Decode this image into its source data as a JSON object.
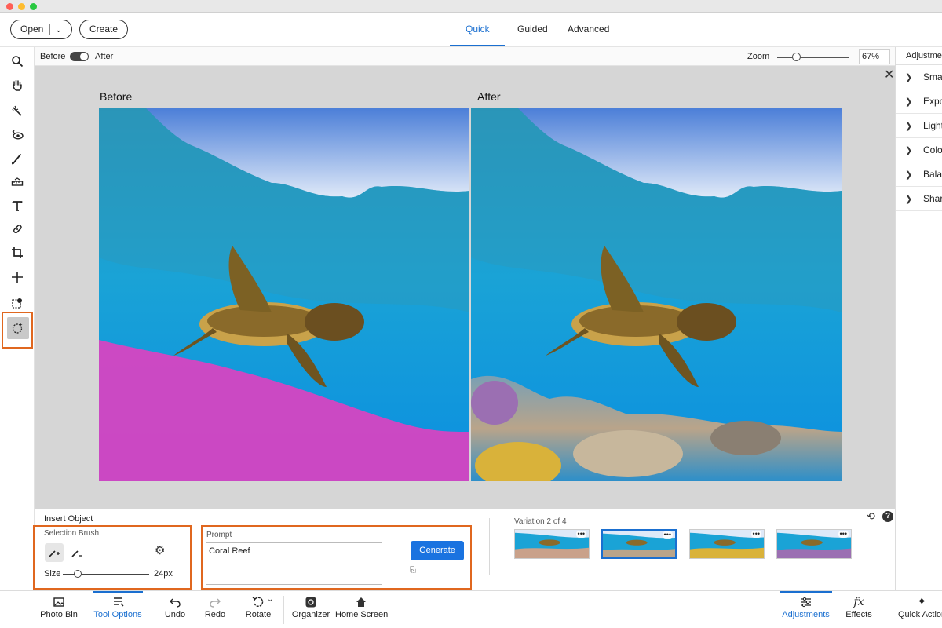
{
  "header": {
    "open_label": "Open",
    "create_label": "Create",
    "modes": [
      "Quick",
      "Guided",
      "Advanced"
    ],
    "active_mode": "Quick"
  },
  "options_bar": {
    "before_label": "Before",
    "after_label": "After",
    "zoom_label": "Zoom",
    "zoom_value": "67%",
    "zoom_level": 0.21
  },
  "canvas": {
    "before_title": "Before",
    "after_title": "After"
  },
  "right_panel": {
    "title": "Adjustments",
    "items": [
      "Smart Fix",
      "Exposure",
      "Lighting",
      "Color",
      "Balance",
      "Sharpen"
    ]
  },
  "tool_options": {
    "title": "Insert Object",
    "brush_section": "Selection Brush",
    "size_label": "Size",
    "size_value": "24px",
    "prompt_label": "Prompt",
    "prompt_value": "Coral Reef",
    "generate_label": "Generate",
    "variation_label": "Variation 2 of 4",
    "selected_variation": 2
  },
  "taskbar": {
    "left": [
      "Photo Bin",
      "Tool Options",
      "Undo",
      "Redo",
      "Rotate",
      "Organizer",
      "Home Screen"
    ],
    "right": [
      "Adjustments",
      "Effects",
      "Quick Actions"
    ]
  },
  "colors": {
    "accent": "#1a6fd0",
    "highlight": "#e0671f",
    "selection_overlay": "#e040c0"
  }
}
